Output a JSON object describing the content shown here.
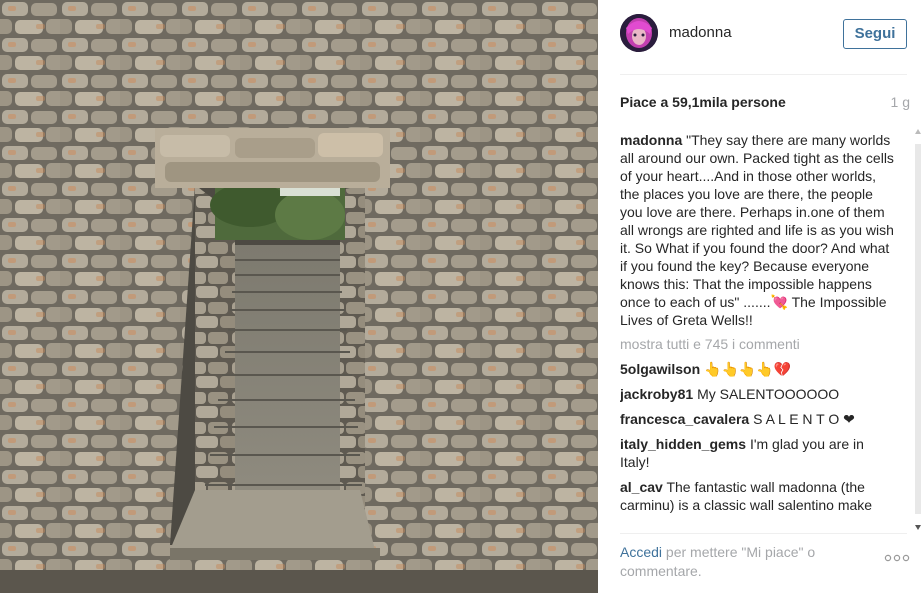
{
  "post": {
    "image_alt": "stone wall archway with stairs",
    "username": "madonna",
    "follow_label": "Segui",
    "likes": "Piace a 59,1mila persone",
    "time": "1 g",
    "caption_user": "madonna",
    "caption_text": "\"They say there are many worlds all around our own. Packed tight as the cells of your heart....And in those other worlds, the places you love are there, the people you love are there. Perhaps in.one of them all wrongs are righted and life is as you wish it. So What if you found the door? And what if you found the key? Because everyone knows this: That the impossible happens once to each of us\" .......💘 The Impossible Lives of Greta Wells!!",
    "show_all_comments": "mostra tutti e 745 i commenti",
    "comments": [
      {
        "user": "5olgawilson",
        "text": "👆👆👆👆💔"
      },
      {
        "user": "jackroby81",
        "text": "My SALENTOOOOOO"
      },
      {
        "user": "francesca_cavalera",
        "text": "S A L E N T O ❤"
      },
      {
        "user": "italy_hidden_gems",
        "text": "I'm glad you are in Italy!"
      },
      {
        "user": "al_cav",
        "text": "The fantastic wall madonna (the carminu) is a classic wall salentino make"
      }
    ],
    "footer": {
      "login_link": "Accedi",
      "login_rest": " per mettere \"Mi piace\" o commentare.",
      "more_icon": "more-options-icon"
    }
  },
  "colors": {
    "link_blue": "#3f729b",
    "muted_gray": "#a5a7aa",
    "text_dark": "#262626",
    "divider": "#efefef"
  }
}
